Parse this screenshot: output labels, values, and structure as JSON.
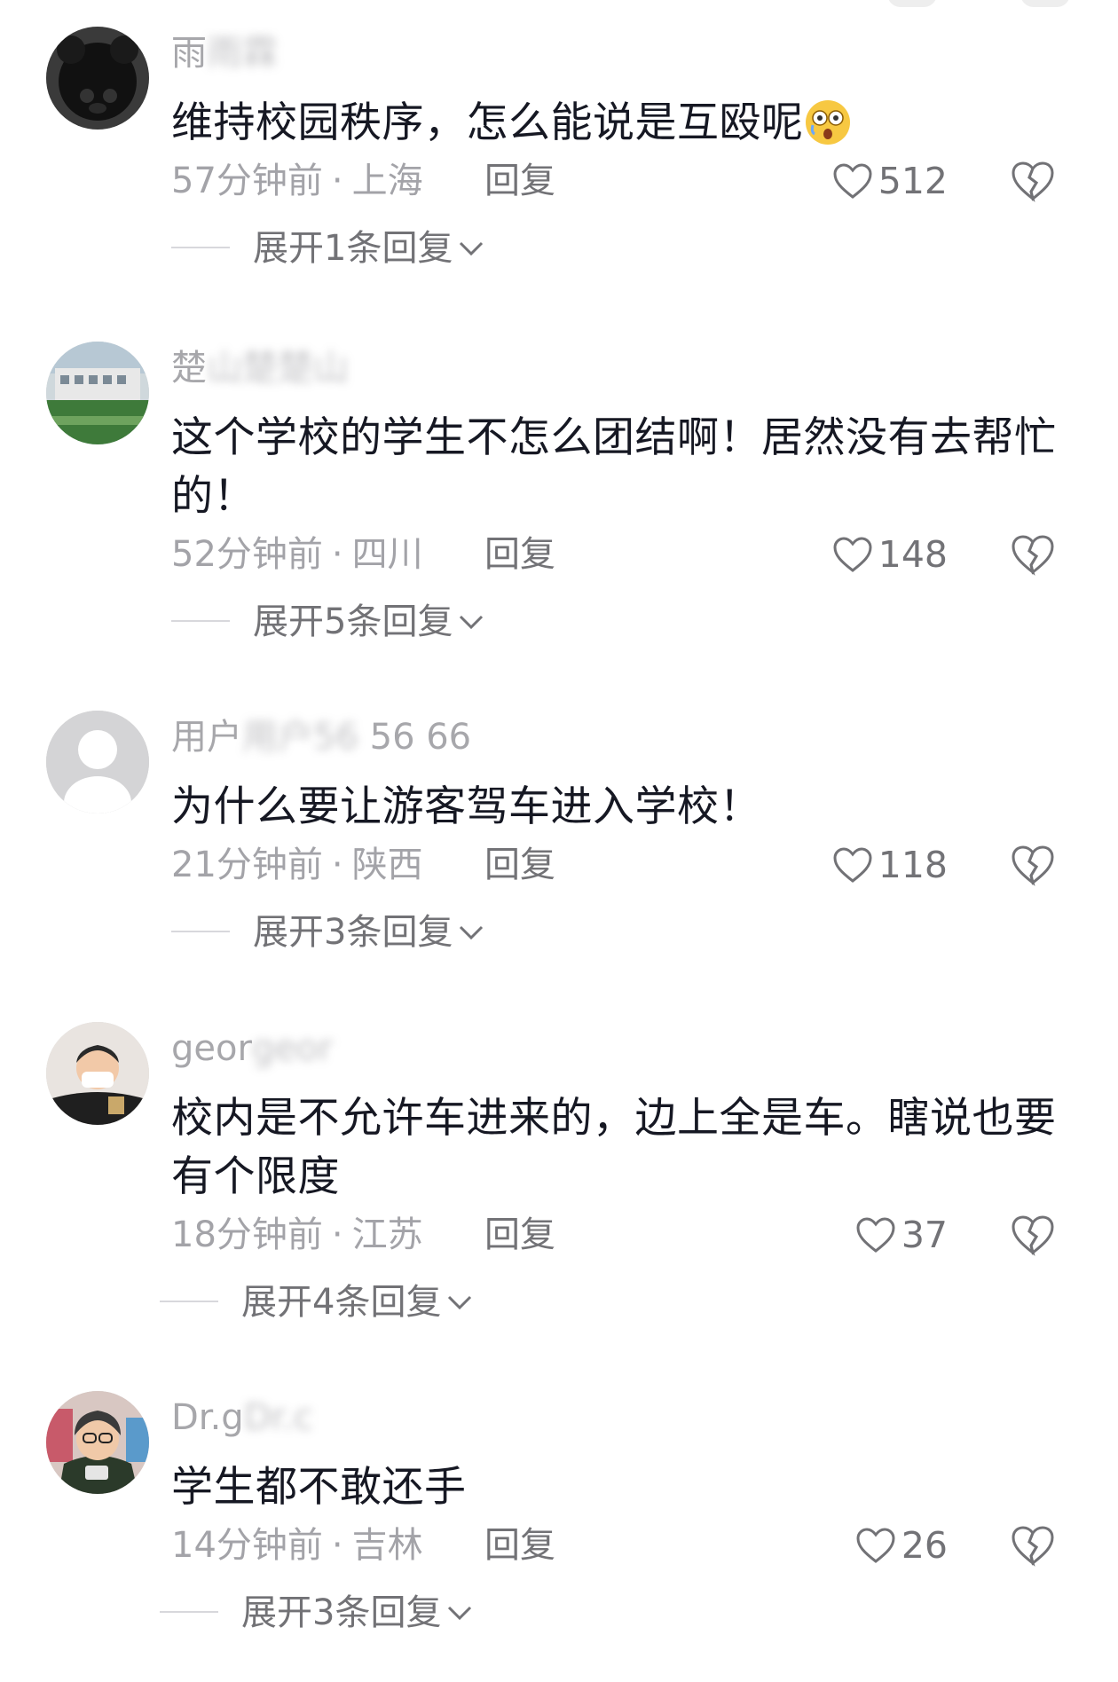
{
  "colors": {
    "text_primary": "#161823",
    "text_secondary": "#a3a3a8",
    "text_action": "#727276",
    "divider": "#d8d8dc"
  },
  "comments": [
    {
      "username": "雨",
      "username_obscured": "霖 雨",
      "content": "维持校园秩序，怎么能说是互殴呢",
      "time": "57分钟前",
      "location": "上海",
      "reply_label": "回复",
      "likes": "512",
      "expand_label": "展开1条回复",
      "emoji": "dizzy-face-emoji"
    },
    {
      "username": "楚",
      "username_obscured": "楚 楚",
      "content": "这个学校的学生不怎么团结啊！居然没有去帮忙的！",
      "time": "52分钟前",
      "location": "四川",
      "reply_label": "回复",
      "likes": "148",
      "expand_label": "展开5条回复"
    },
    {
      "username": "用户",
      "username_obscured": "用户 56 66",
      "content": "为什么要让游客驾车进入学校！",
      "time": "21分钟前",
      "location": "陕西",
      "reply_label": "回复",
      "likes": "118",
      "expand_label": "展开3条回复"
    },
    {
      "username": "geor",
      "username_obscured": "geor geor",
      "content": "校内是不允许车进来的，边上全是车。瞎说也要有个限度",
      "time": "18分钟前",
      "location": "江苏",
      "reply_label": "回复",
      "likes": "37",
      "expand_label": "展开4条回复"
    },
    {
      "username": "Dr.g",
      "username_obscured": "Dr.g Dr.c",
      "content": "学生都不敢还手",
      "time": "14分钟前",
      "location": "吉林",
      "reply_label": "回复",
      "likes": "26",
      "expand_label": "展开3条回复"
    }
  ],
  "icons": {
    "like": "heart-icon",
    "dislike": "broken-heart-icon",
    "expand": "chevron-down-icon"
  },
  "meta_separator": "·"
}
